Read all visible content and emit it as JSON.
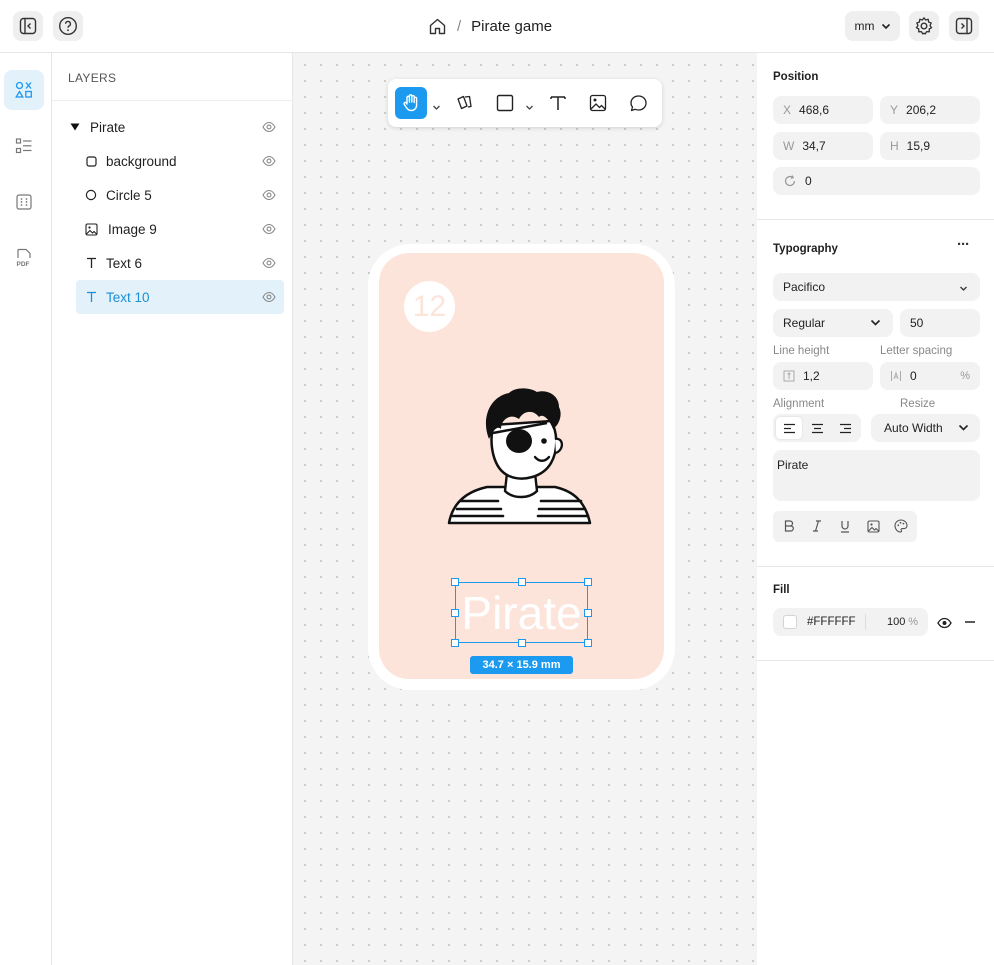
{
  "header": {
    "breadcrumb_title": "Pirate game",
    "unit": "mm"
  },
  "layers": {
    "title": "LAYERS",
    "items": [
      {
        "label": "Pirate",
        "icon": "triangle-down-icon"
      },
      {
        "label": "background",
        "icon": "square-icon"
      },
      {
        "label": "Circle 5",
        "icon": "circle-icon"
      },
      {
        "label": "Image 9",
        "icon": "image-icon"
      },
      {
        "label": "Text 6",
        "icon": "text-icon"
      },
      {
        "label": "Text 10",
        "icon": "text-icon",
        "selected": true
      }
    ]
  },
  "canvas": {
    "badge_number": "12",
    "selected_text": "Pirate",
    "dimension_label": "34.7 × 15.9 mm"
  },
  "position": {
    "title": "Position",
    "x_label": "X",
    "x": "468,6",
    "y_label": "Y",
    "y": "206,2",
    "w_label": "W",
    "w": "34,7",
    "h_label": "H",
    "h": "15,9",
    "rotation": "0"
  },
  "typography": {
    "title": "Typography",
    "more": "···",
    "font": "Pacifico",
    "weight": "Regular",
    "size": "50",
    "line_height_label": "Line height",
    "line_height": "1,2",
    "letter_spacing_label": "Letter spacing",
    "letter_spacing": "0",
    "letter_spacing_unit": "%",
    "alignment_label": "Alignment",
    "resize_label": "Resize",
    "resize": "Auto Width",
    "content": "Pirate"
  },
  "fill": {
    "title": "Fill",
    "hex": "#FFFFFF",
    "opacity": "100",
    "opacity_unit": "%"
  },
  "colors": {
    "accent": "#1b9af0",
    "card": "#fde4db",
    "selected_row": "#e3f1fb"
  }
}
